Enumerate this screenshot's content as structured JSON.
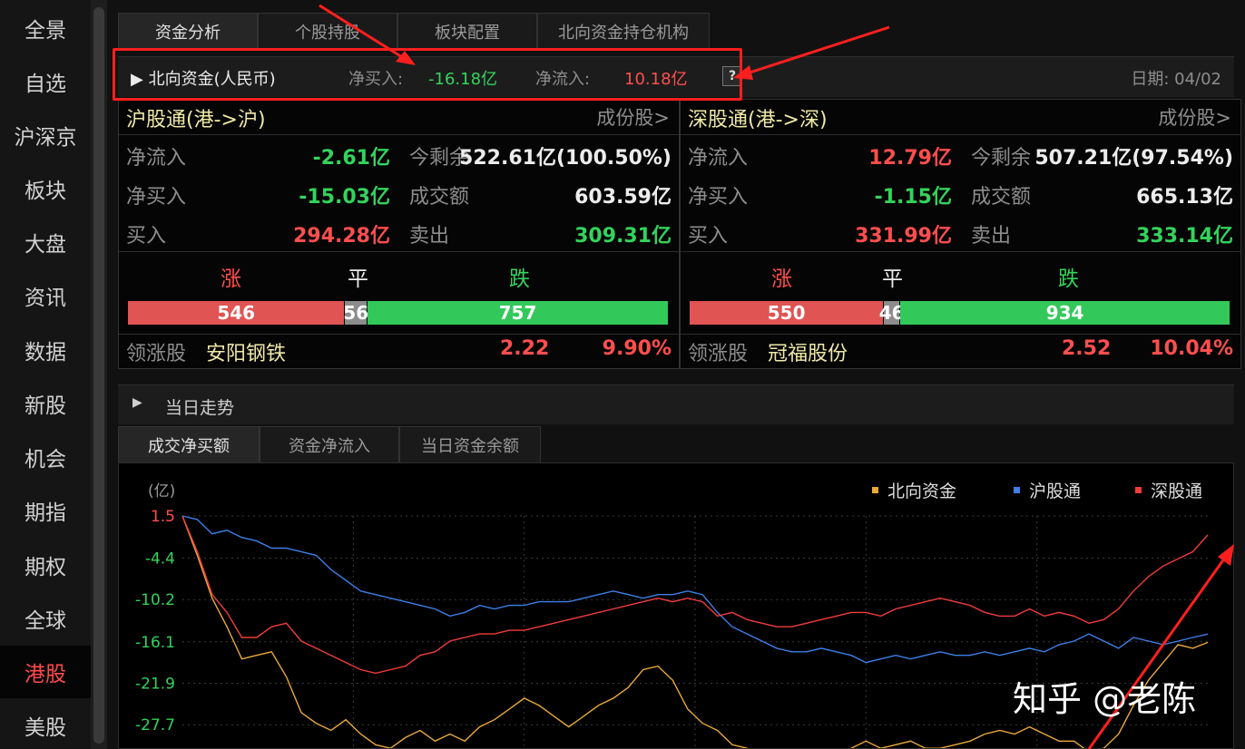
{
  "sidebar": {
    "items": [
      "全景",
      "自选",
      "沪深京",
      "板块",
      "大盘",
      "资讯",
      "数据",
      "新股",
      "机会",
      "期指",
      "期权",
      "全球",
      "港股",
      "美股"
    ],
    "active": "港股"
  },
  "tabs": [
    "资金分析",
    "个股持股",
    "板块配置",
    "北向资金持仓机构"
  ],
  "northbound": {
    "title": "▶ 北向资金(人民币)",
    "net_buy_label": "净买入:",
    "net_buy": "-16.18亿",
    "net_inflow_label": "净流入:",
    "net_inflow": "10.18亿",
    "help": "?",
    "date": "日期: 04/02"
  },
  "hgt": {
    "title": "沪股通(港->沪)",
    "link": "成份股>",
    "net_inflow_label": "净流入",
    "net_inflow": "-2.61亿",
    "remaining_label": "今剩余",
    "remaining": "522.61亿(100.50%)",
    "net_buy_label": "净买入",
    "net_buy": "-15.03亿",
    "turnover_label": "成交额",
    "turnover": "603.59亿",
    "buy_label": "买入",
    "buy": "294.28亿",
    "sell_label": "卖出",
    "sell": "309.31亿",
    "up_label": "涨",
    "flat_label": "平",
    "down_label": "跌",
    "up": "546",
    "flat": "56",
    "down": "757",
    "leader_label": "领涨股",
    "leader_name": "安阳钢铁",
    "leader_price": "2.22",
    "leader_pct": "9.90%"
  },
  "sgt": {
    "title": "深股通(港->深)",
    "link": "成份股>",
    "net_inflow_label": "净流入",
    "net_inflow": "12.79亿",
    "remaining_label": "今剩余",
    "remaining": "507.21亿(97.54%)",
    "net_buy_label": "净买入",
    "net_buy": "-1.15亿",
    "turnover_label": "成交额",
    "turnover": "665.13亿",
    "buy_label": "买入",
    "buy": "331.99亿",
    "sell_label": "卖出",
    "sell": "333.14亿",
    "up_label": "涨",
    "flat_label": "平",
    "down_label": "跌",
    "up": "550",
    "flat": "46",
    "down": "934",
    "leader_label": "领涨股",
    "leader_name": "冠福股份",
    "leader_price": "2.52",
    "leader_pct": "10.04%"
  },
  "trend": {
    "title": "当日走势",
    "tabs": [
      "成交净买额",
      "资金净流入",
      "当日资金余额"
    ]
  },
  "chart_data": {
    "type": "line",
    "ylabel": "(亿)",
    "y_ticks": [
      "1.5",
      "-4.4",
      "-10.2",
      "-16.1",
      "-21.9",
      "-27.7"
    ],
    "ylim": [
      -33.0,
      1.5
    ],
    "grid": true,
    "legend_position": "top-right",
    "series": [
      {
        "name": "北向资金",
        "color": "#e8a93a",
        "values": [
          1.5,
          -4.0,
          -10.0,
          -14.0,
          -18.5,
          -18.0,
          -17.5,
          -21.0,
          -26.0,
          -27.5,
          -28.5,
          -27.0,
          -29.0,
          -30.5,
          -31.0,
          -29.5,
          -28.5,
          -30.0,
          -29.0,
          -30.0,
          -28.0,
          -27.0,
          -25.5,
          -24.0,
          -25.0,
          -26.5,
          -28.0,
          -26.5,
          -25.0,
          -24.0,
          -22.5,
          -20.0,
          -19.5,
          -21.5,
          -25.5,
          -27.5,
          -28.5,
          -30.5,
          -31.0,
          -32.5,
          -33.0,
          -32.0,
          -32.0,
          -31.5,
          -32.0,
          -31.0,
          -30.0,
          -31.0,
          -30.5,
          -30.0,
          -31.0,
          -31.0,
          -30.5,
          -30.0,
          -29.0,
          -28.5,
          -29.0,
          -28.0,
          -29.0,
          -30.0,
          -30.0,
          -31.5,
          -31.0,
          -29.0,
          -25.0,
          -21.5,
          -19.0,
          -16.5,
          -17.0,
          -16.18
        ]
      },
      {
        "name": "沪股通",
        "color": "#3d7fe6",
        "values": [
          1.5,
          1.0,
          -1.0,
          -0.5,
          -1.5,
          -2.0,
          -3.0,
          -3.0,
          -3.5,
          -4.0,
          -6.0,
          -7.5,
          -9.0,
          -9.5,
          -10.0,
          -10.5,
          -11.0,
          -11.5,
          -12.5,
          -12.0,
          -11.0,
          -11.5,
          -11.0,
          -11.0,
          -10.5,
          -10.5,
          -10.5,
          -10.0,
          -9.5,
          -9.0,
          -9.5,
          -10.0,
          -9.5,
          -9.5,
          -9.0,
          -9.5,
          -12.0,
          -14.0,
          -15.0,
          -16.0,
          -17.0,
          -17.5,
          -17.5,
          -17.0,
          -17.5,
          -18.0,
          -19.0,
          -18.5,
          -18.0,
          -18.5,
          -18.0,
          -17.5,
          -18.0,
          -18.0,
          -17.5,
          -18.0,
          -17.5,
          -17.0,
          -17.5,
          -16.5,
          -16.0,
          -15.0,
          -16.0,
          -17.0,
          -15.5,
          -16.0,
          -16.5,
          -16.0,
          -15.5,
          -15.03
        ]
      },
      {
        "name": "深股通",
        "color": "#f03c3c",
        "values": [
          1.5,
          -3.5,
          -9.5,
          -12.0,
          -15.5,
          -15.5,
          -14.0,
          -13.5,
          -16.0,
          -17.0,
          -18.0,
          -19.0,
          -20.0,
          -20.5,
          -20.0,
          -19.5,
          -18.0,
          -17.5,
          -16.0,
          -15.5,
          -15.0,
          -15.0,
          -14.5,
          -14.5,
          -14.0,
          -13.5,
          -13.0,
          -12.5,
          -12.0,
          -11.5,
          -11.0,
          -10.5,
          -10.0,
          -10.5,
          -10.0,
          -10.5,
          -12.5,
          -12.0,
          -13.0,
          -13.5,
          -14.0,
          -14.0,
          -13.5,
          -13.0,
          -12.5,
          -12.0,
          -12.0,
          -12.5,
          -11.5,
          -11.0,
          -10.5,
          -10.0,
          -10.5,
          -11.0,
          -12.0,
          -12.5,
          -12.5,
          -11.5,
          -12.5,
          -12.0,
          -12.5,
          -13.5,
          -13.0,
          -11.5,
          -9.0,
          -7.0,
          -5.5,
          -4.5,
          -3.5,
          -1.15
        ]
      }
    ]
  },
  "watermark": "知乎 @老陈"
}
